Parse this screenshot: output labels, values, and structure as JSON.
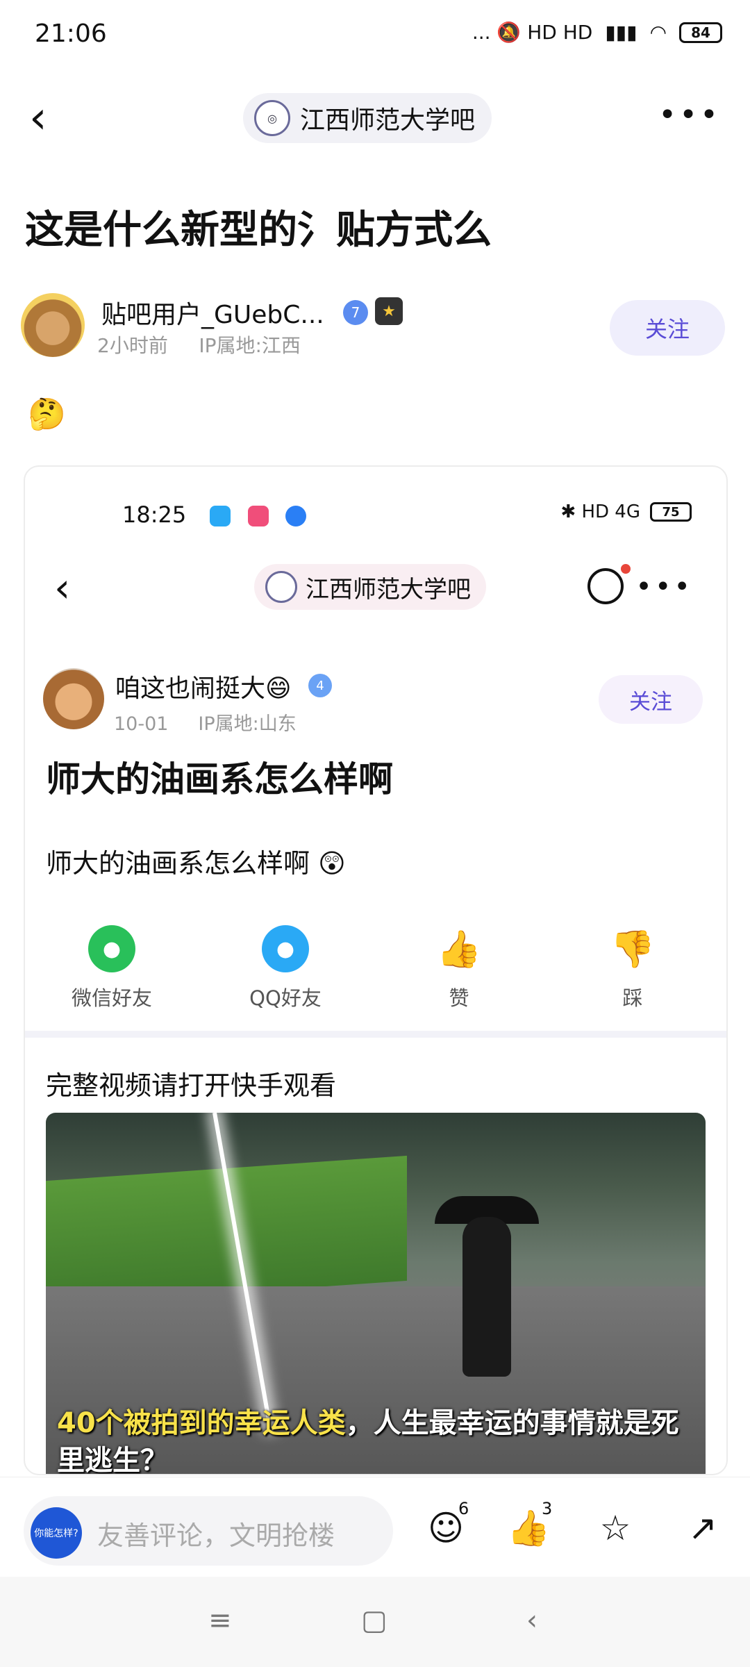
{
  "status_bar": {
    "time": "21:06",
    "right": "... 🔕 HD HD",
    "battery": "84"
  },
  "header": {
    "forum_name": "江西师范大学吧",
    "more": "•••"
  },
  "post": {
    "title": "这是什么新型的氵贴方式么",
    "author": {
      "name": "贴吧用户_GUebC...",
      "level": "7",
      "time": "2小时前",
      "ip": "IP属地:江西"
    },
    "follow_label": "关注",
    "emoji": "🤔"
  },
  "embedded": {
    "status": {
      "time": "18:25",
      "battery": "75",
      "right": "✱ HD 4G"
    },
    "forum_name": "江西师范大学吧",
    "author": {
      "name": "咱这也闹挺大😄",
      "level": "4",
      "date": "10-01",
      "ip": "IP属地:山东"
    },
    "follow_label": "关注",
    "title": "师大的油画系怎么样啊",
    "body": "师大的油画系怎么样啊 😲",
    "share": [
      {
        "label": "微信好友",
        "icon": "wechat-icon",
        "color": "#29c05a"
      },
      {
        "label": "QQ好友",
        "icon": "qq-icon",
        "color": "#2aa9f5"
      },
      {
        "label": "赞",
        "icon": "thumb-up-icon",
        "color": "#ffffff"
      },
      {
        "label": "踩",
        "icon": "thumb-down-icon",
        "color": "#ffffff"
      }
    ],
    "video_hint": "完整视频请打开快手观看",
    "video_caption_highlight": "40个被拍到的幸运人类",
    "video_caption_rest": "，人生最幸运的事情就是死里逃生？"
  },
  "comment_bar": {
    "placeholder": "友善评论，文明抢楼",
    "avatar_text": "你能怎样?",
    "comment_count": "6",
    "like_count": "3"
  },
  "nav": {
    "menu": "≡",
    "home": "▢",
    "back": "‹"
  }
}
